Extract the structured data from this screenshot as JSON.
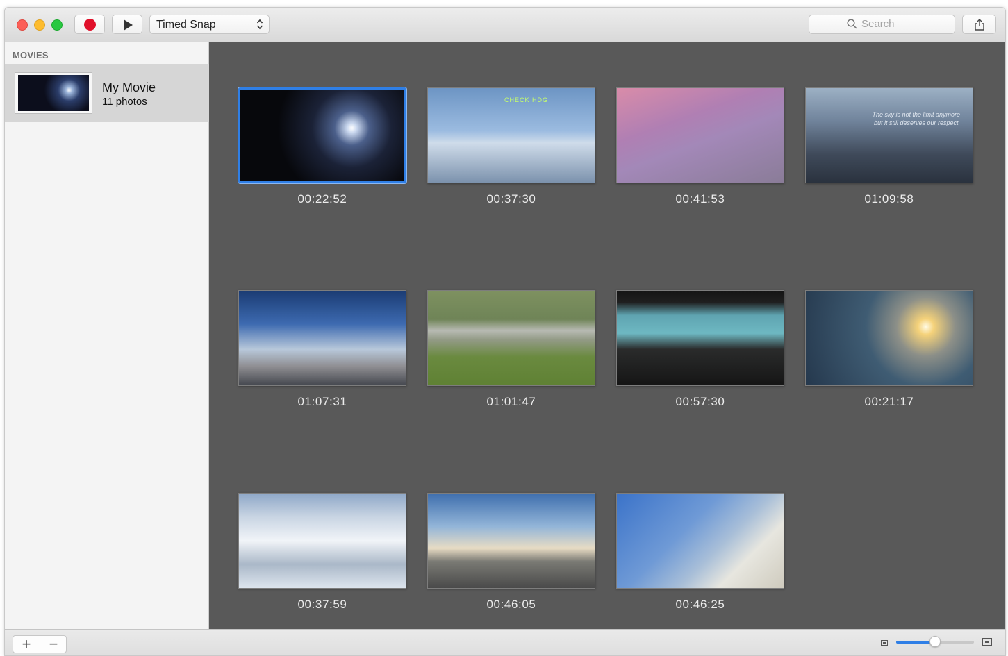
{
  "toolbar": {
    "record_icon": "record-icon",
    "play_icon": "play-icon",
    "mode": "Timed Snap",
    "search_placeholder": "Search",
    "share_icon": "share-icon"
  },
  "sidebar": {
    "heading": "MOVIES",
    "movie": {
      "title": "My Movie",
      "count": "11 photos"
    }
  },
  "snapshots": [
    {
      "time": "00:22:52",
      "selected": true
    },
    {
      "time": "00:37:30",
      "overlay": "CHECK HDG"
    },
    {
      "time": "00:41:53"
    },
    {
      "time": "01:09:58",
      "overlay_lines": [
        "The sky is not the limit anymore",
        "but it still deserves our respect."
      ]
    },
    {
      "time": "01:07:31"
    },
    {
      "time": "01:01:47"
    },
    {
      "time": "00:57:30"
    },
    {
      "time": "00:21:17"
    },
    {
      "time": "00:37:59"
    },
    {
      "time": "00:46:05"
    },
    {
      "time": "00:46:25"
    }
  ],
  "footer": {
    "add_label": "+",
    "remove_label": "−",
    "zoom_level": 0.5
  },
  "colors": {
    "accent": "#2f7fe6",
    "record": "#e0102a"
  }
}
